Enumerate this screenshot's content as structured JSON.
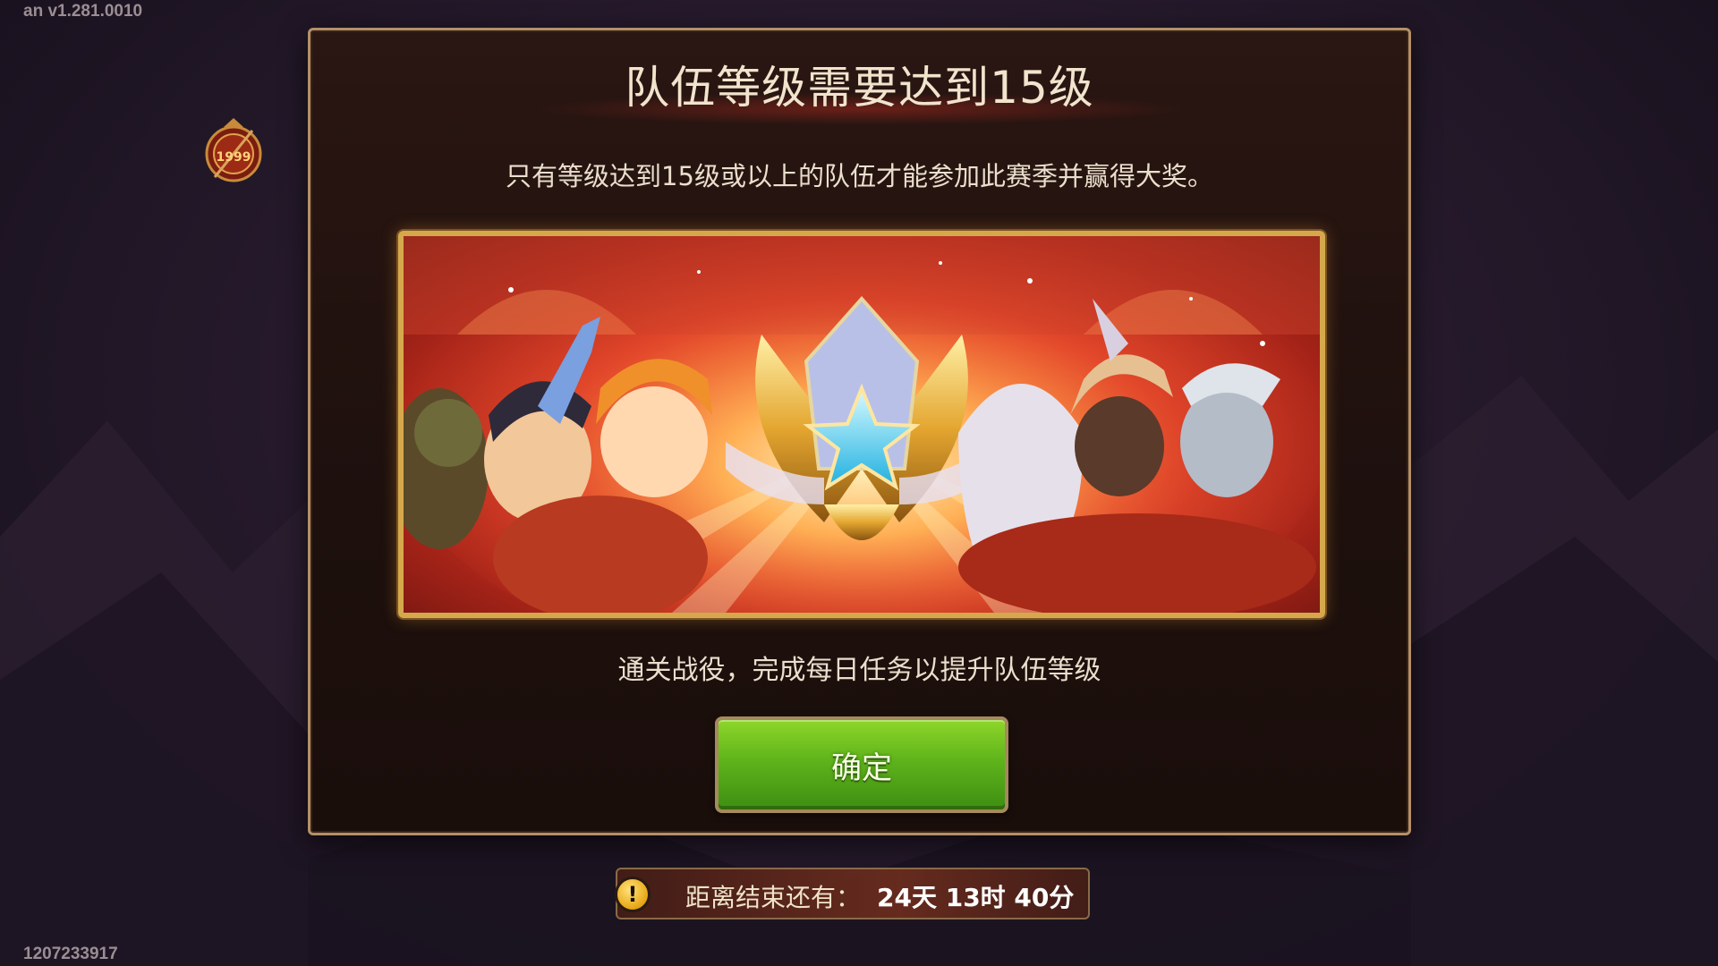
{
  "version_text": "an v1.281.0010",
  "account_id": "1207233917",
  "logo": {
    "icon": "game-logo-icon",
    "text": "1999"
  },
  "dialog": {
    "title": "队伍等级需要达到15级",
    "description": "只有等级达到15级或以上的队伍才能参加此赛季并赢得大奖。",
    "banner": {
      "icon": "season-emblem-icon"
    },
    "hint": "通关战役，完成每日任务以提升队伍等级",
    "confirm_label": "确定"
  },
  "countdown": {
    "icon": "warning-icon",
    "icon_glyph": "!",
    "label": "距离结束还有：",
    "value": "24天 13时 40分"
  },
  "colors": {
    "accent_gold": "#d6a84c",
    "button_green": "#5fb41b",
    "dialog_border": "#b49068"
  }
}
